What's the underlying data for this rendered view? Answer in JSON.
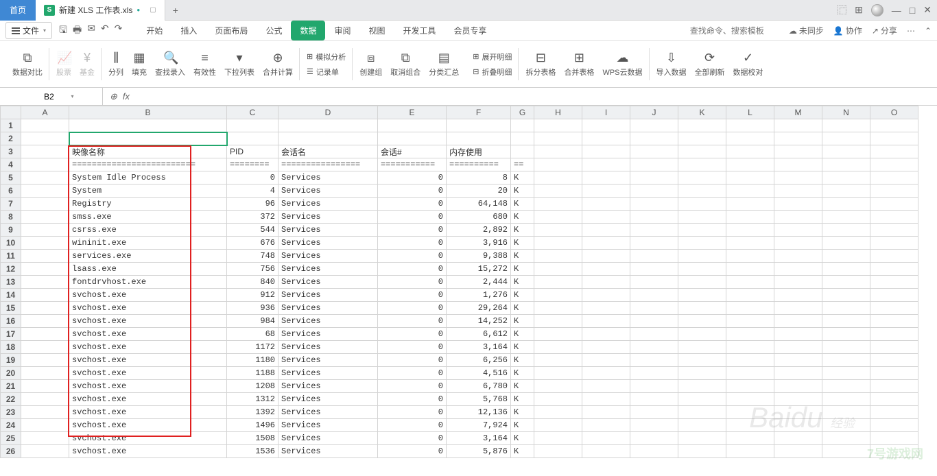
{
  "titlebar": {
    "home": "首页",
    "file_tab": "新建 XLS 工作表.xls",
    "file_prefix": "S",
    "add": "+"
  },
  "menu": {
    "file": "文件",
    "tabs": [
      "开始",
      "插入",
      "页面布局",
      "公式",
      "数据",
      "审阅",
      "视图",
      "开发工具",
      "会员专享"
    ],
    "active_index": 4,
    "search_placeholder": "查找命令、搜索模板",
    "sync": "未同步",
    "coop": "协作",
    "share": "分享"
  },
  "ribbon": {
    "g1": {
      "label": "数据对比"
    },
    "g2": {
      "a": "股票",
      "b": "基金"
    },
    "g3": {
      "a": "分列",
      "b": "填充",
      "c": "查找录入",
      "d": "有效性",
      "e": "下拉列表",
      "f": "合并计算",
      "g": "模拟分析",
      "h": "记录单"
    },
    "g4": {
      "a": "创建组",
      "b": "取消组合",
      "c": "分类汇总",
      "d": "展开明细",
      "e": "折叠明细"
    },
    "g5": {
      "a": "拆分表格",
      "b": "合并表格",
      "c": "WPS云数据"
    },
    "g6": {
      "a": "导入数据",
      "b": "全部刷新",
      "c": "数据校对"
    }
  },
  "fx": {
    "cell": "B2",
    "fx": "fx"
  },
  "cols": [
    "A",
    "B",
    "C",
    "D",
    "E",
    "F",
    "G",
    "H",
    "I",
    "J",
    "K",
    "L",
    "M",
    "N",
    "O"
  ],
  "headers": {
    "B": "映像名称",
    "C": "PID",
    "D": "会话名",
    "E": "会话#",
    "F": "内存使用"
  },
  "sep": {
    "B": "=========================",
    "C": "========",
    "D": "================",
    "E": "===========",
    "F": "==========",
    "G": "=="
  },
  "rows": [
    {
      "b": "System Idle Process",
      "c": "0",
      "d": "Services",
      "e": "0",
      "f": "8",
      "g": "K"
    },
    {
      "b": "System",
      "c": "4",
      "d": "Services",
      "e": "0",
      "f": "20",
      "g": "K"
    },
    {
      "b": "Registry",
      "c": "96",
      "d": "Services",
      "e": "0",
      "f": "64,148",
      "g": "K"
    },
    {
      "b": "smss.exe",
      "c": "372",
      "d": "Services",
      "e": "0",
      "f": "680",
      "g": "K"
    },
    {
      "b": "csrss.exe",
      "c": "544",
      "d": "Services",
      "e": "0",
      "f": "2,892",
      "g": "K"
    },
    {
      "b": "wininit.exe",
      "c": "676",
      "d": "Services",
      "e": "0",
      "f": "3,916",
      "g": "K"
    },
    {
      "b": "services.exe",
      "c": "748",
      "d": "Services",
      "e": "0",
      "f": "9,388",
      "g": "K"
    },
    {
      "b": "lsass.exe",
      "c": "756",
      "d": "Services",
      "e": "0",
      "f": "15,272",
      "g": "K"
    },
    {
      "b": "fontdrvhost.exe",
      "c": "840",
      "d": "Services",
      "e": "0",
      "f": "2,444",
      "g": "K"
    },
    {
      "b": "svchost.exe",
      "c": "912",
      "d": "Services",
      "e": "0",
      "f": "1,276",
      "g": "K"
    },
    {
      "b": "svchost.exe",
      "c": "936",
      "d": "Services",
      "e": "0",
      "f": "29,264",
      "g": "K"
    },
    {
      "b": "svchost.exe",
      "c": "984",
      "d": "Services",
      "e": "0",
      "f": "14,252",
      "g": "K"
    },
    {
      "b": "svchost.exe",
      "c": "68",
      "d": "Services",
      "e": "0",
      "f": "6,612",
      "g": "K"
    },
    {
      "b": "svchost.exe",
      "c": "1172",
      "d": "Services",
      "e": "0",
      "f": "3,164",
      "g": "K"
    },
    {
      "b": "svchost.exe",
      "c": "1180",
      "d": "Services",
      "e": "0",
      "f": "6,256",
      "g": "K"
    },
    {
      "b": "svchost.exe",
      "c": "1188",
      "d": "Services",
      "e": "0",
      "f": "4,516",
      "g": "K"
    },
    {
      "b": "svchost.exe",
      "c": "1208",
      "d": "Services",
      "e": "0",
      "f": "6,780",
      "g": "K"
    },
    {
      "b": "svchost.exe",
      "c": "1312",
      "d": "Services",
      "e": "0",
      "f": "5,768",
      "g": "K"
    },
    {
      "b": "svchost.exe",
      "c": "1392",
      "d": "Services",
      "e": "0",
      "f": "12,136",
      "g": "K"
    },
    {
      "b": "svchost.exe",
      "c": "1496",
      "d": "Services",
      "e": "0",
      "f": "7,924",
      "g": "K"
    },
    {
      "b": "svchost.exe",
      "c": "1508",
      "d": "Services",
      "e": "0",
      "f": "3,164",
      "g": "K"
    },
    {
      "b": "svchost.exe",
      "c": "1536",
      "d": "Services",
      "e": "0",
      "f": "5,876",
      "g": "K"
    }
  ],
  "watermark1": "Baidu",
  "watermark1_sub": "经验",
  "watermark2": "7号游戏网"
}
